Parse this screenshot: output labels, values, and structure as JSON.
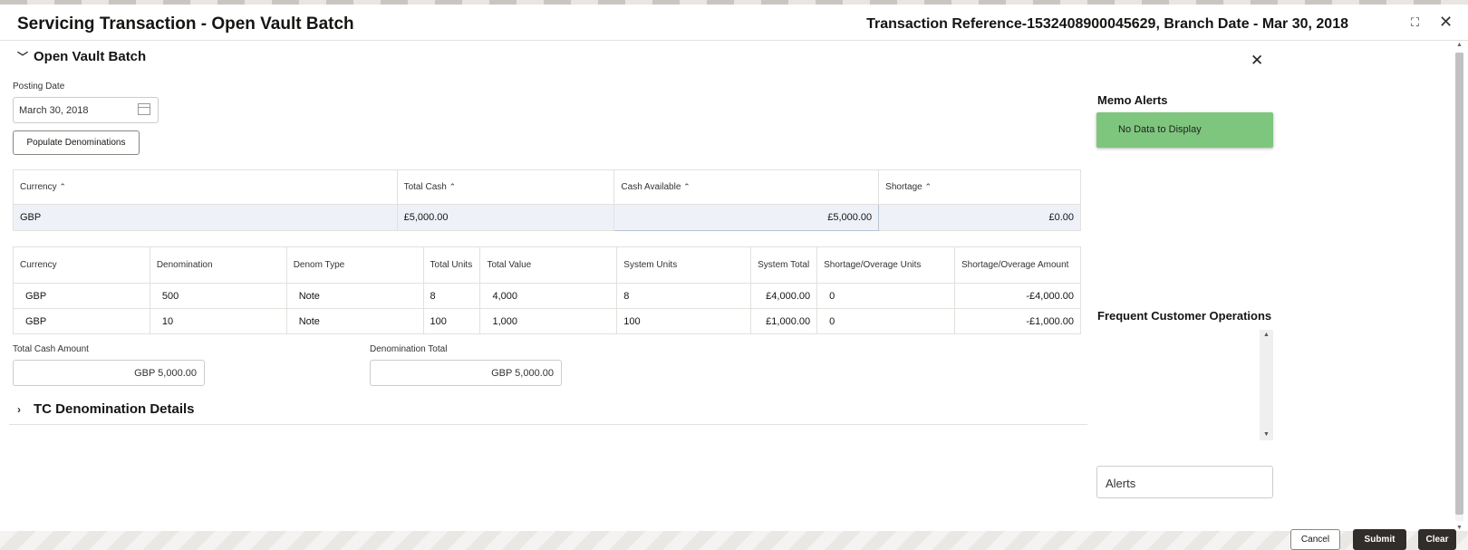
{
  "header": {
    "title": "Servicing Transaction - Open Vault Batch",
    "reference": "Transaction Reference-1532408900045629, Branch Date - Mar 30, 2018",
    "expand_glyph": "⛶",
    "close_glyph": "✕"
  },
  "section_open": {
    "title": "Open Vault Batch",
    "posting_date_label": "Posting Date",
    "posting_date_value": "March 30, 2018",
    "populate_button": "Populate Denominations"
  },
  "summary_table": {
    "headers": [
      "Currency",
      "Total Cash",
      "Cash Available",
      "Shortage"
    ],
    "sort_glyph": "⌃⌄",
    "rows": [
      [
        "GBP",
        "£5,000.00",
        "£5,000.00",
        "£0.00"
      ]
    ]
  },
  "denom_table": {
    "headers": [
      "Currency",
      "Denomination",
      "Denom Type",
      "Total Units",
      "Total Value",
      "System Units",
      "System Total",
      "Shortage/Overage Units",
      "Shortage/Overage Amount"
    ],
    "rows": [
      [
        "GBP",
        "500",
        "Note",
        "8",
        "4,000",
        "8",
        "£4,000.00",
        "0",
        "-£4,000.00"
      ],
      [
        "GBP",
        "10",
        "Note",
        "100",
        "1,000",
        "100",
        "£1,000.00",
        "0",
        "-£1,000.00"
      ]
    ]
  },
  "totals": {
    "total_cash_label": "Total Cash Amount",
    "total_cash_value": "GBP 5,000.00",
    "denom_total_label": "Denomination Total",
    "denom_total_value": "GBP 5,000.00"
  },
  "section_tc": {
    "title": "TC Denomination Details"
  },
  "right_panel": {
    "memo_title": "Memo Alerts",
    "memo_empty": "No Data to Display",
    "frequent_title": "Frequent Customer Operations",
    "alerts_label": "Alerts"
  },
  "footer": {
    "cancel": "Cancel",
    "submit": "Submit",
    "clear": "Clear"
  }
}
